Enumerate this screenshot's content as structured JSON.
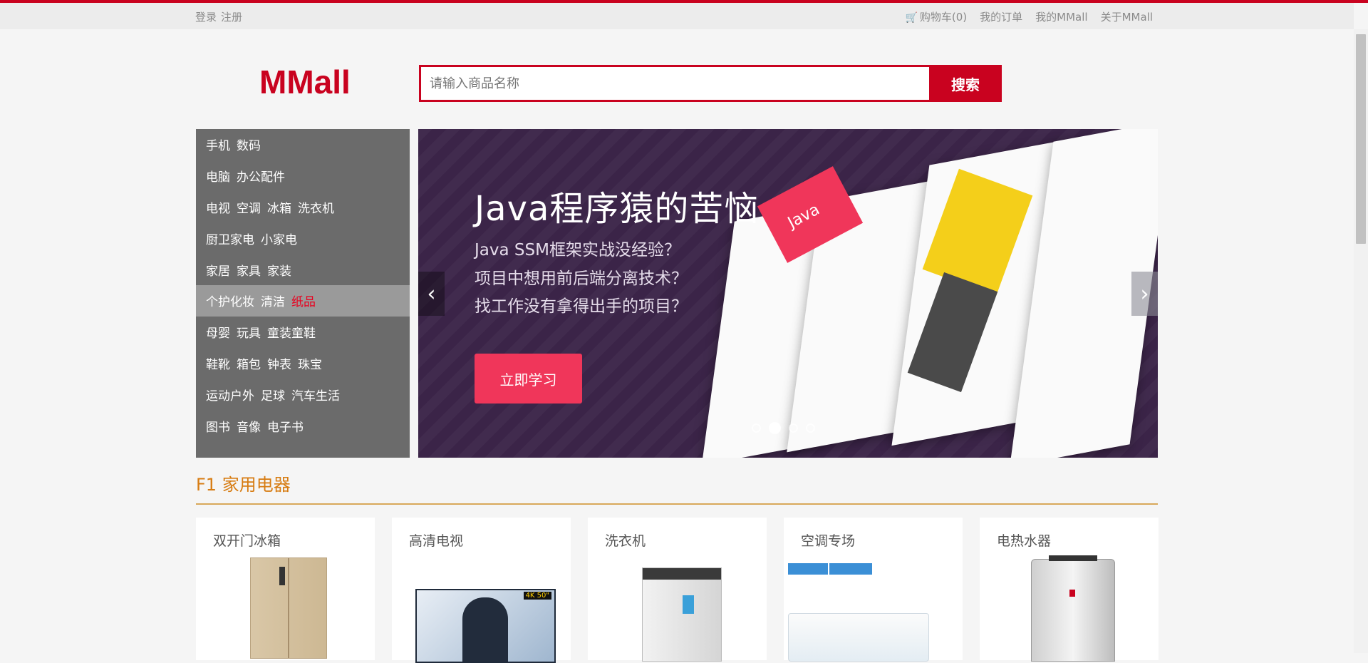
{
  "topbar": {
    "login": "登录",
    "register": "注册",
    "cart": "购物车(0)",
    "orders": "我的订单",
    "my_mmall": "我的MMall",
    "about": "关于MMall"
  },
  "logo": "MMall",
  "search": {
    "placeholder": "请输入商品名称",
    "button": "搜索"
  },
  "categories": [
    [
      "手机",
      "数码"
    ],
    [
      "电脑",
      "办公配件"
    ],
    [
      "电视",
      "空调",
      "冰箱",
      "洗衣机"
    ],
    [
      "厨卫家电",
      "小家电"
    ],
    [
      "家居",
      "家具",
      "家装"
    ],
    [
      "个护化妆",
      "清洁",
      "纸品"
    ],
    [
      "母婴",
      "玩具",
      "童装童鞋"
    ],
    [
      "鞋靴",
      "箱包",
      "钟表",
      "珠宝"
    ],
    [
      "运动户外",
      "足球",
      "汽车生活"
    ],
    [
      "图书",
      "音像",
      "电子书"
    ]
  ],
  "banner": {
    "title": "Java程序猿的苦恼",
    "lines": [
      "Java SSM框架实战没经验？",
      "项目中想用前后端分离技术？",
      "找工作没有拿得出手的项目？"
    ],
    "button": "立即学习",
    "slide_count": 4,
    "active_slide": 1
  },
  "floor": {
    "title": "F1 家用电器",
    "products": [
      "双开门冰箱",
      "高清电视",
      "洗衣机",
      "空调专场",
      "电热水器"
    ]
  },
  "colors": {
    "brand": "#c9021f",
    "floor": "#d77c12",
    "menu_bg": "#6b6b6b"
  }
}
